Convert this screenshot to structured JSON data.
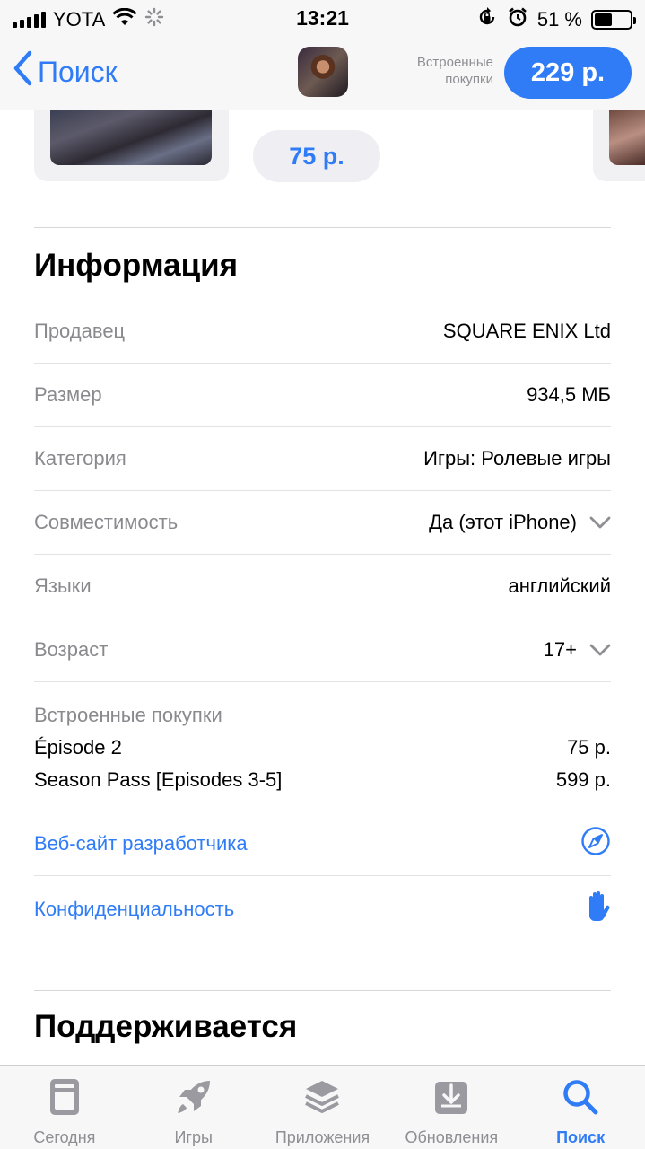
{
  "status_bar": {
    "carrier": "YOTA",
    "time": "13:21",
    "battery_percent": "51 %",
    "battery_level": 0.51
  },
  "nav": {
    "back_label": "Поиск",
    "iap_label": "Встроенные покупки",
    "price": "229 р."
  },
  "screenshots": {
    "card_price": "75 р."
  },
  "info": {
    "title": "Информация",
    "rows": [
      {
        "key": "Продавец",
        "value": "SQUARE ENIX Ltd"
      },
      {
        "key": "Размер",
        "value": "934,5 МБ"
      },
      {
        "key": "Категория",
        "value": "Игры: Ролевые игры"
      },
      {
        "key": "Совместимость",
        "value": "Да (этот iPhone)"
      },
      {
        "key": "Языки",
        "value": "английский"
      },
      {
        "key": "Возраст",
        "value": "17+"
      }
    ],
    "iap": {
      "label": "Встроенные покупки",
      "items": [
        {
          "name": "Épisode 2",
          "price": "75 р."
        },
        {
          "name": "Season Pass [Episodes 3-5]",
          "price": "599 р."
        }
      ]
    },
    "links": {
      "developer_site": "Веб-сайт разработчика",
      "privacy": "Конфиденциальность"
    }
  },
  "supported": {
    "title": "Поддерживается"
  },
  "tabs": [
    {
      "label": "Сегодня",
      "icon": "today-icon"
    },
    {
      "label": "Игры",
      "icon": "rocket-icon"
    },
    {
      "label": "Приложения",
      "icon": "layers-icon"
    },
    {
      "label": "Обновления",
      "icon": "download-tray-icon"
    },
    {
      "label": "Поиск",
      "icon": "search-icon",
      "active": true
    }
  ],
  "colors": {
    "accent": "#2f7cf6",
    "secondary_text": "#8a8a8e",
    "bar_background": "#f7f7f8"
  }
}
